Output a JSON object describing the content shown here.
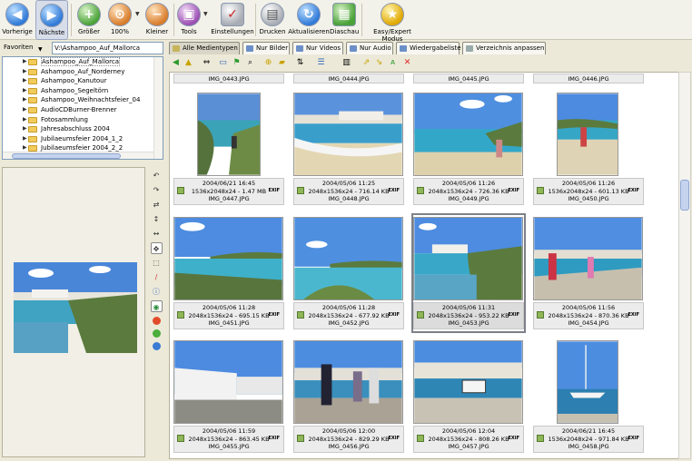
{
  "toolbar": {
    "buttons": [
      {
        "label": "Vorherige",
        "icon": "arrow-left-icon"
      },
      {
        "label": "Nächste",
        "icon": "arrow-right-icon"
      },
      {
        "label": "Größer",
        "icon": "zoom-in-icon"
      },
      {
        "label": "100%",
        "icon": "zoom-100-icon"
      },
      {
        "label": "Kleiner",
        "icon": "zoom-out-icon"
      },
      {
        "label": "Tools",
        "icon": "tools-icon"
      },
      {
        "label": "Einstellungen",
        "icon": "settings-icon"
      },
      {
        "label": "Drucken",
        "icon": "printer-icon"
      },
      {
        "label": "Aktualisieren",
        "icon": "refresh-icon"
      },
      {
        "label": "Diaschau",
        "icon": "slideshow-icon"
      },
      {
        "label": "Easy/Expert Modus",
        "icon": "star-icon"
      }
    ]
  },
  "left": {
    "favorites_label": "Favoriten",
    "path": "V:\\Ashampoo_Auf_Mallorca",
    "tree": [
      "Ashampoo_Auf_Mallorca",
      "Ashampoo_Auf_Norderney",
      "Ashampoo_Kanutour",
      "Ashampoo_Segeltörn",
      "Ashampoo_Weihnachtsfeier_04",
      "AudioCDBurner-Brenner",
      "Fotosammlung",
      "Jahresabschluss 2004",
      "Jubilaeumsfeier 2004_1_2",
      "Jubilaeumsfeier 2004_2_2"
    ]
  },
  "tabs": [
    "Alle Medientypen",
    "Nur Bilder",
    "Nur Videos",
    "Nur Audio",
    "Wiedergabeliste",
    "Verzeichnis anpassen"
  ],
  "gallery": {
    "top_row": [
      "IMG_0443.JPG",
      "IMG_0444.JPG",
      "IMG_0445.JPG",
      "IMG_0446.JPG"
    ],
    "exif_label": "EXIF",
    "items": [
      {
        "date": "2004/06/21 16:45",
        "info": "1536x2048x24 - 1.47 MB",
        "name": "IMG_0447.JPG"
      },
      {
        "date": "2004/05/06 11:25",
        "info": "2048x1536x24 - 716.14 KB",
        "name": "IMG_0448.JPG"
      },
      {
        "date": "2004/05/06 11:26",
        "info": "2048x1536x24 - 726.36 KB",
        "name": "IMG_0449.JPG"
      },
      {
        "date": "2004/05/06 11:26",
        "info": "1536x2048x24 - 601.13 KB",
        "name": "IMG_0450.JPG"
      },
      {
        "date": "2004/05/06 11:28",
        "info": "2048x1536x24 - 695.15 KB",
        "name": "IMG_0451.JPG"
      },
      {
        "date": "2004/05/06 11:28",
        "info": "2048x1536x24 - 677.92 KB",
        "name": "IMG_0452.JPG"
      },
      {
        "date": "2004/05/06 11:31",
        "info": "2048x1536x24 - 953.22 KB",
        "name": "IMG_0453.JPG"
      },
      {
        "date": "2004/05/06 11:56",
        "info": "2048x1536x24 - 870.36 KB",
        "name": "IMG_0454.JPG"
      },
      {
        "date": "2004/05/06 11:59",
        "info": "2048x1536x24 - 863.45 KB",
        "name": "IMG_0455.JPG"
      },
      {
        "date": "2004/05/06 12:00",
        "info": "2048x1536x24 - 829.29 KB",
        "name": "IMG_0456.JPG"
      },
      {
        "date": "2004/05/06 12:04",
        "info": "2048x1536x24 - 808.26 KB",
        "name": "IMG_0457.JPG"
      },
      {
        "date": "2004/06/21 16:45",
        "info": "1536x2048x24 - 971.84 KB",
        "name": "IMG_0458.JPG"
      }
    ]
  }
}
